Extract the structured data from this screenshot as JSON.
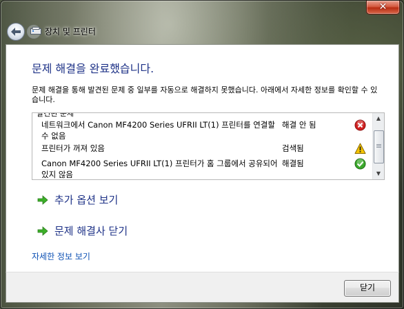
{
  "window": {
    "title": "장치 및 프린터",
    "close_label": "✕"
  },
  "main": {
    "heading": "문제 해결을 완료했습니다.",
    "description": "문제 해결을 통해 발견된 문제 중 일부를 자동으로 해결하지 못했습니다. 아래에서 자세한 정보를 확인할 수 있습니다.",
    "list_clipped_header": "발견된 문제",
    "issues": [
      {
        "message": "네트워크에서 Canon MF4200 Series UFRII LT(1) 프린터를 연결할 수 없음",
        "status": "해결 안 됨",
        "icon": "error-icon",
        "icon_color": "#d02020"
      },
      {
        "message": "프린터가 꺼져 있음",
        "status": "검색됨",
        "icon": "warning-icon",
        "icon_color": "#f0c000"
      },
      {
        "message": "Canon MF4200 Series UFRII LT(1) 프린터가 홈 그룹에서 공유되어 있지 않음",
        "status": "해결됨",
        "icon": "check-icon",
        "icon_color": "#3aa82a"
      }
    ],
    "options": [
      {
        "label": "추가 옵션 보기"
      },
      {
        "label": "문제 해결사 닫기"
      }
    ],
    "details_link": "자세한 정보 보기"
  },
  "footer": {
    "close_button": "닫기"
  },
  "colors": {
    "heading": "#1e3287",
    "link": "#0b4fb3"
  }
}
